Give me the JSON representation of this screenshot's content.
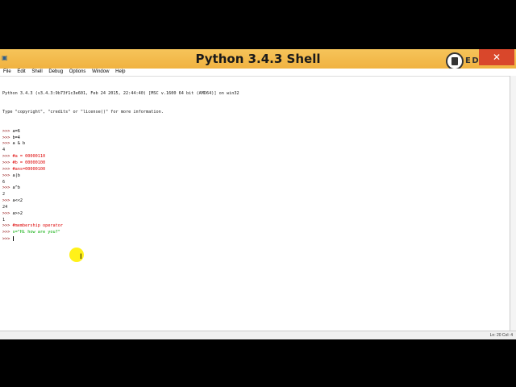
{
  "window": {
    "title": "Python 3.4.3 Shell",
    "close_label": "✕",
    "logo_text": "EDUCBA",
    "app_icon": "python-icon"
  },
  "menu": [
    "File",
    "Edit",
    "Shell",
    "Debug",
    "Options",
    "Window",
    "Help"
  ],
  "shell": {
    "banner": "Python 3.4.3 (v3.4.3:9b73f1c3e601, Feb 24 2015, 22:44:40) [MSC v.1600 64 bit (AMD64)] on win32",
    "hint": "Type \"copyright\", \"credits\" or \"license()\" for more information.",
    "prompt": ">>> ",
    "lines": [
      {
        "kind": "cmd",
        "text": "a=6"
      },
      {
        "kind": "cmd",
        "text": "b=4"
      },
      {
        "kind": "cmd",
        "text": "a & b"
      },
      {
        "kind": "out",
        "text": "4"
      },
      {
        "kind": "comment",
        "text": "#a = 00000110"
      },
      {
        "kind": "comment",
        "text": "#b = 00000100"
      },
      {
        "kind": "comment",
        "text": "#ans=00000100"
      },
      {
        "kind": "cmd",
        "text": "a|b"
      },
      {
        "kind": "out",
        "text": "6"
      },
      {
        "kind": "cmd",
        "text": "a^b"
      },
      {
        "kind": "out",
        "text": "2"
      },
      {
        "kind": "cmd",
        "text": "a<<2"
      },
      {
        "kind": "out",
        "text": "24"
      },
      {
        "kind": "cmd",
        "text": "a>>2"
      },
      {
        "kind": "out",
        "text": "1"
      },
      {
        "kind": "comment",
        "text": "#membership operator"
      },
      {
        "kind": "string",
        "text": "s=\"Hi how are you?\""
      },
      {
        "kind": "cursor",
        "text": ""
      }
    ]
  },
  "status": {
    "text": "Ln: 20 Col: 4"
  },
  "colors": {
    "titlebar": "#f0b240",
    "prompt": "#8b0000",
    "comment": "#dd0000",
    "string": "#00aa00"
  }
}
